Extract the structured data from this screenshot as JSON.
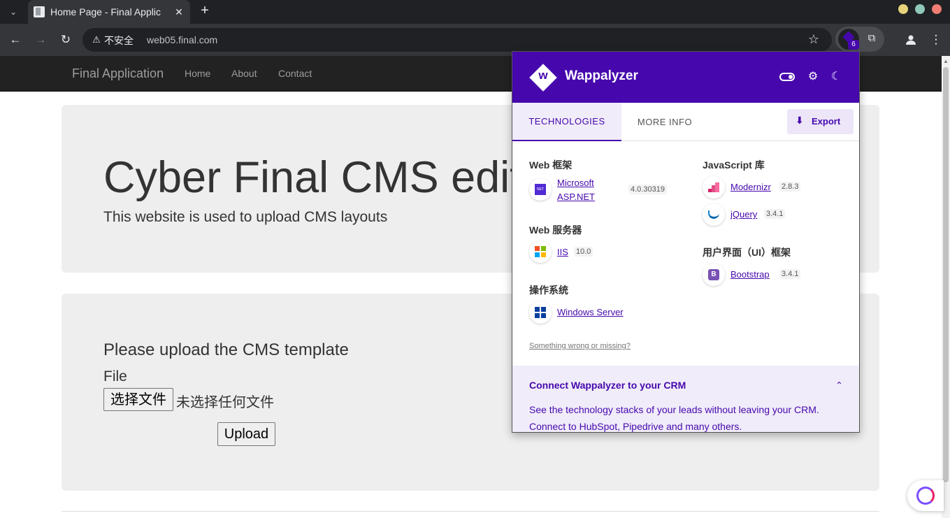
{
  "browser": {
    "tab_title": "Home Page - Final Applic",
    "tab_close": "✕",
    "new_tab": "+",
    "insecure_label": "不安全",
    "url": "web05.final.com",
    "extension_badge": "6"
  },
  "page": {
    "brand": "Final Application",
    "nav": [
      "Home",
      "About",
      "Contact"
    ],
    "jumbotron": {
      "title": "Cyber Final CMS edit",
      "lead": "This website is used to upload CMS layouts"
    },
    "upload": {
      "title": "Please upload the CMS template",
      "file_label": "File",
      "choose_button": "选择文件",
      "no_file": "未选择任何文件",
      "upload_button": "Upload"
    }
  },
  "wappalyzer": {
    "name": "Wappalyzer",
    "tabs": [
      "TECHNOLOGIES",
      "MORE INFO"
    ],
    "export_label": "Export",
    "categories": {
      "web_framework": {
        "title": "Web 框架",
        "items": [
          {
            "name_line1": "Microsoft",
            "name_line2": "ASP.NET",
            "version": "4.0.30319",
            "icon": "dotnet-icon"
          }
        ]
      },
      "web_server": {
        "title": "Web 服务器",
        "items": [
          {
            "name": "IIS",
            "version": "10.0",
            "icon": "microsoft-icon"
          }
        ]
      },
      "os": {
        "title": "操作系统",
        "items": [
          {
            "name": "Windows Server",
            "icon": "windows-icon"
          }
        ]
      },
      "js_lib": {
        "title": "JavaScript 库",
        "items": [
          {
            "name": "Modernizr",
            "version": "2.8.3",
            "icon": "modernizr-icon"
          },
          {
            "name": "jQuery",
            "version": "3.4.1",
            "icon": "jquery-icon"
          }
        ]
      },
      "ui_framework": {
        "title": "用户界面（UI）框架",
        "items": [
          {
            "name": "Bootstrap",
            "version": "3.4.1",
            "icon": "bootstrap-icon"
          }
        ]
      }
    },
    "something_wrong": "Something wrong or missing?",
    "crm": {
      "title": "Connect Wappalyzer to your CRM",
      "text": "See the technology stacks of your leads without leaving your CRM. Connect to HubSpot, Pipedrive and many others."
    }
  },
  "colors": {
    "wappalyzer_purple": "#4608ad",
    "navbar": "#222222",
    "jumbotron": "#eeeeee"
  }
}
